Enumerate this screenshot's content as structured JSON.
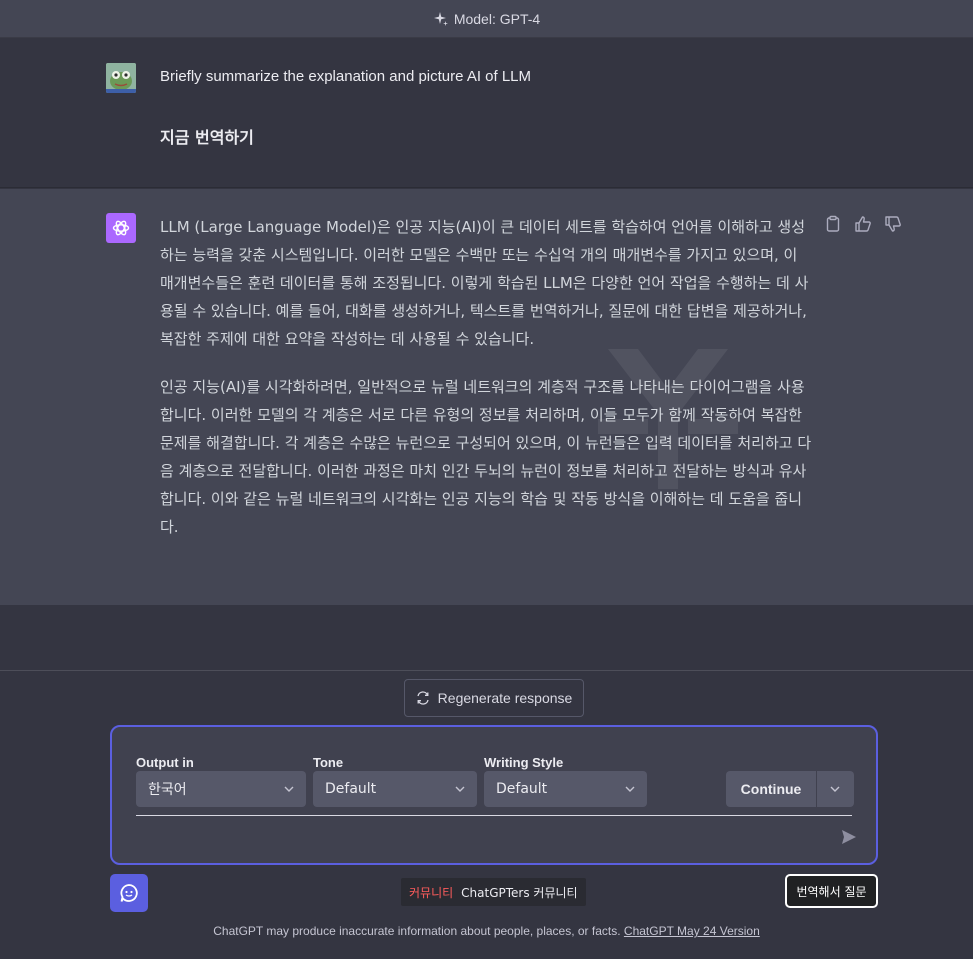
{
  "header": {
    "model_label": "Model: GPT-4"
  },
  "user_message": {
    "line1": "Briefly summarize the explanation and picture AI of LLM",
    "line2": "지금 번역하기"
  },
  "assistant_message": {
    "paragraphs": [
      "LLM (Large Language Model)은 인공 지능(AI)이 큰 데이터 세트를 학습하여 언어를 이해하고 생성하는 능력을 갖춘 시스템입니다. 이러한 모델은 수백만 또는 수십억 개의 매개변수를 가지고 있으며, 이 매개변수들은 훈련 데이터를 통해 조정됩니다. 이렇게 학습된 LLM은 다양한 언어 작업을 수행하는 데 사용될 수 있습니다. 예를 들어, 대화를 생성하거나, 텍스트를 번역하거나, 질문에 대한 답변을 제공하거나, 복잡한 주제에 대한 요약을 작성하는 데 사용될 수 있습니다.",
      "인공 지능(AI)를 시각화하려면, 일반적으로 뉴럴 네트워크의 계층적 구조를 나타내는 다이어그램을 사용합니다. 이러한 모델의 각 계층은 서로 다른 유형의 정보를 처리하며, 이들 모두가 함께 작동하여 복잡한 문제를 해결합니다. 각 계층은 수많은 뉴런으로 구성되어 있으며, 이 뉴런들은 입력 데이터를 처리하고 다음 계층으로 전달합니다. 이러한 과정은 마치 인간 두뇌의 뉴런이 정보를 처리하고 전달하는 방식과 유사합니다. 이와 같은 뉴럴 네트워크의 시각화는 인공 지능의 학습 및 작동 방식을 이해하는 데 도움을 줍니다."
    ]
  },
  "regenerate": {
    "label": "Regenerate response"
  },
  "composer": {
    "output_label": "Output in",
    "output_value": "한국어",
    "tone_label": "Tone",
    "tone_value": "Default",
    "style_label": "Writing Style",
    "style_value": "Default",
    "continue_label": "Continue"
  },
  "community": {
    "red_text": "커뮤니티",
    "white_text": "ChatGPTers 커뮤니티"
  },
  "translate_button": {
    "label": "번역해서 질문"
  },
  "footer": {
    "text": "ChatGPT may produce inaccurate information about people, places, or facts. ",
    "link": "ChatGPT May 24 Version"
  },
  "colors": {
    "accent": "#5b5fe0",
    "gpt_logo": "#ab68ff",
    "assistant_bg": "#444654",
    "page_bg": "#343541"
  }
}
